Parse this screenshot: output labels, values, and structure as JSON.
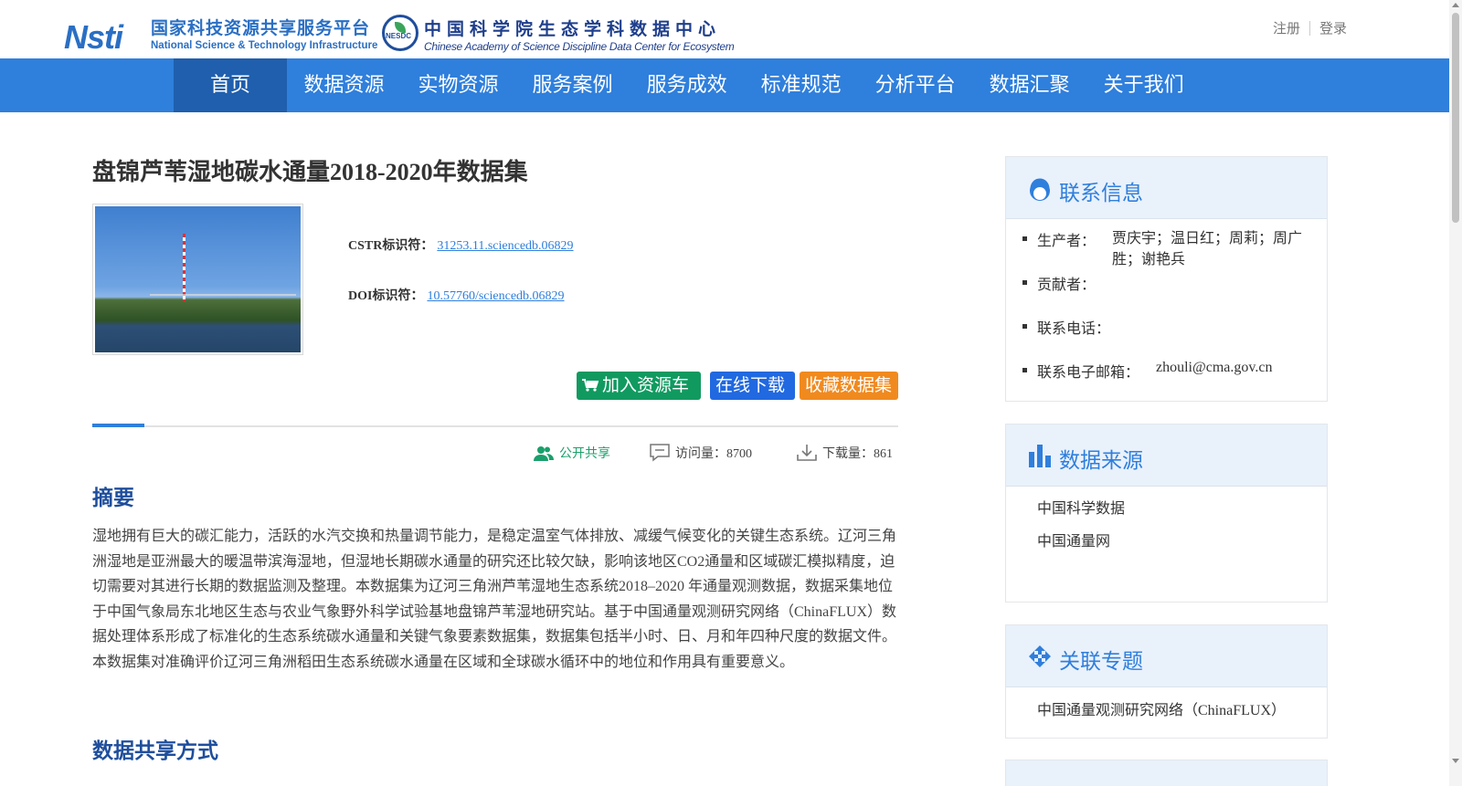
{
  "header": {
    "logo_nsti_mark": "Nsti",
    "logo_nsti_cn": "国家科技资源共享服务平台",
    "logo_nsti_en": "National Science & Technology Infrastructure",
    "logo_nesdc_mark": "NESDC",
    "logo_nesdc_cn": "中国科学院生态学科数据中心",
    "logo_nesdc_en": "Chinese Academy of Science Discipline Data Center for Ecosystem",
    "register": "注册",
    "login": "登录"
  },
  "nav": {
    "items": [
      "首页",
      "数据资源",
      "实物资源",
      "服务案例",
      "服务成效",
      "标准规范",
      "分析平台",
      "数据汇聚",
      "关于我们"
    ],
    "active": "首页"
  },
  "dataset": {
    "title": "盘锦芦苇湿地碳水通量2018-2020年数据集",
    "cstr_label": "CSTR标识符：",
    "cstr_value": "31253.11.sciencedb.06829",
    "doi_label": "DOI标识符：",
    "doi_value": "10.57760/sciencedb.06829",
    "btn_cart": "加入资源车",
    "btn_download": "在线下载",
    "btn_favorite": "收藏数据集",
    "share_mode": "公开共享",
    "visits": "访问量：8700",
    "downloads": "下载量：861",
    "abstract_heading": "摘要",
    "abstract": "湿地拥有巨大的碳汇能力，活跃的水汽交换和热量调节能力，是稳定温室气体排放、减缓气候变化的关键生态系统。辽河三角洲湿地是亚洲最大的暖温带滨海湿地，但湿地长期碳水通量的研究还比较欠缺，影响该地区CO2通量和区域碳汇模拟精度，迫切需要对其进行长期的数据监测及整理。本数据集为辽河三角洲芦苇湿地生态系统2018–2020 年通量观测数据，数据采集地位于中国气象局东北地区生态与农业气象野外科学试验基地盘锦芦苇湿地研究站。基于中国通量观测研究网络（ChinaFLUX）数据处理体系形成了标准化的生态系统碳水通量和关键气象要素数据集，数据集包括半小时、日、月和年四种尺度的数据文件。本数据集对准确评价辽河三角洲稻田生态系统碳水通量在区域和全球碳水循环中的地位和作用具有重要意义。",
    "sharing_heading": "数据共享方式"
  },
  "sidebar": {
    "contact": {
      "title": "联系信息",
      "producer_label": "生产者：",
      "producer_value": "贾庆宇；温日红；周莉；周广胜；谢艳兵",
      "contributor_label": "贡献者：",
      "contributor_value": "",
      "phone_label": "联系电话：",
      "phone_value": "",
      "email_label": "联系电子邮箱：",
      "email_value": "zhouli@cma.gov.cn"
    },
    "source": {
      "title": "数据来源",
      "items": [
        "中国科学数据",
        "中国通量网"
      ]
    },
    "topics": {
      "title": "关联专题",
      "items": [
        "中国通量观测研究网络（ChinaFLUX）"
      ]
    }
  },
  "colors": {
    "nav_bg": "#2f7fdc",
    "nav_active": "#1f5fae",
    "btn_cart": "#119a60",
    "btn_download": "#2169e0",
    "btn_favorite": "#f08a1f",
    "heading": "#1f4e9c"
  },
  "icons": {
    "cart": "cart-icon",
    "share": "users-icon",
    "visits": "comment-icon",
    "downloads": "download-icon",
    "contact": "user-headset-icon",
    "source": "bar-chart-icon",
    "topics": "diamond-arrows-icon"
  }
}
